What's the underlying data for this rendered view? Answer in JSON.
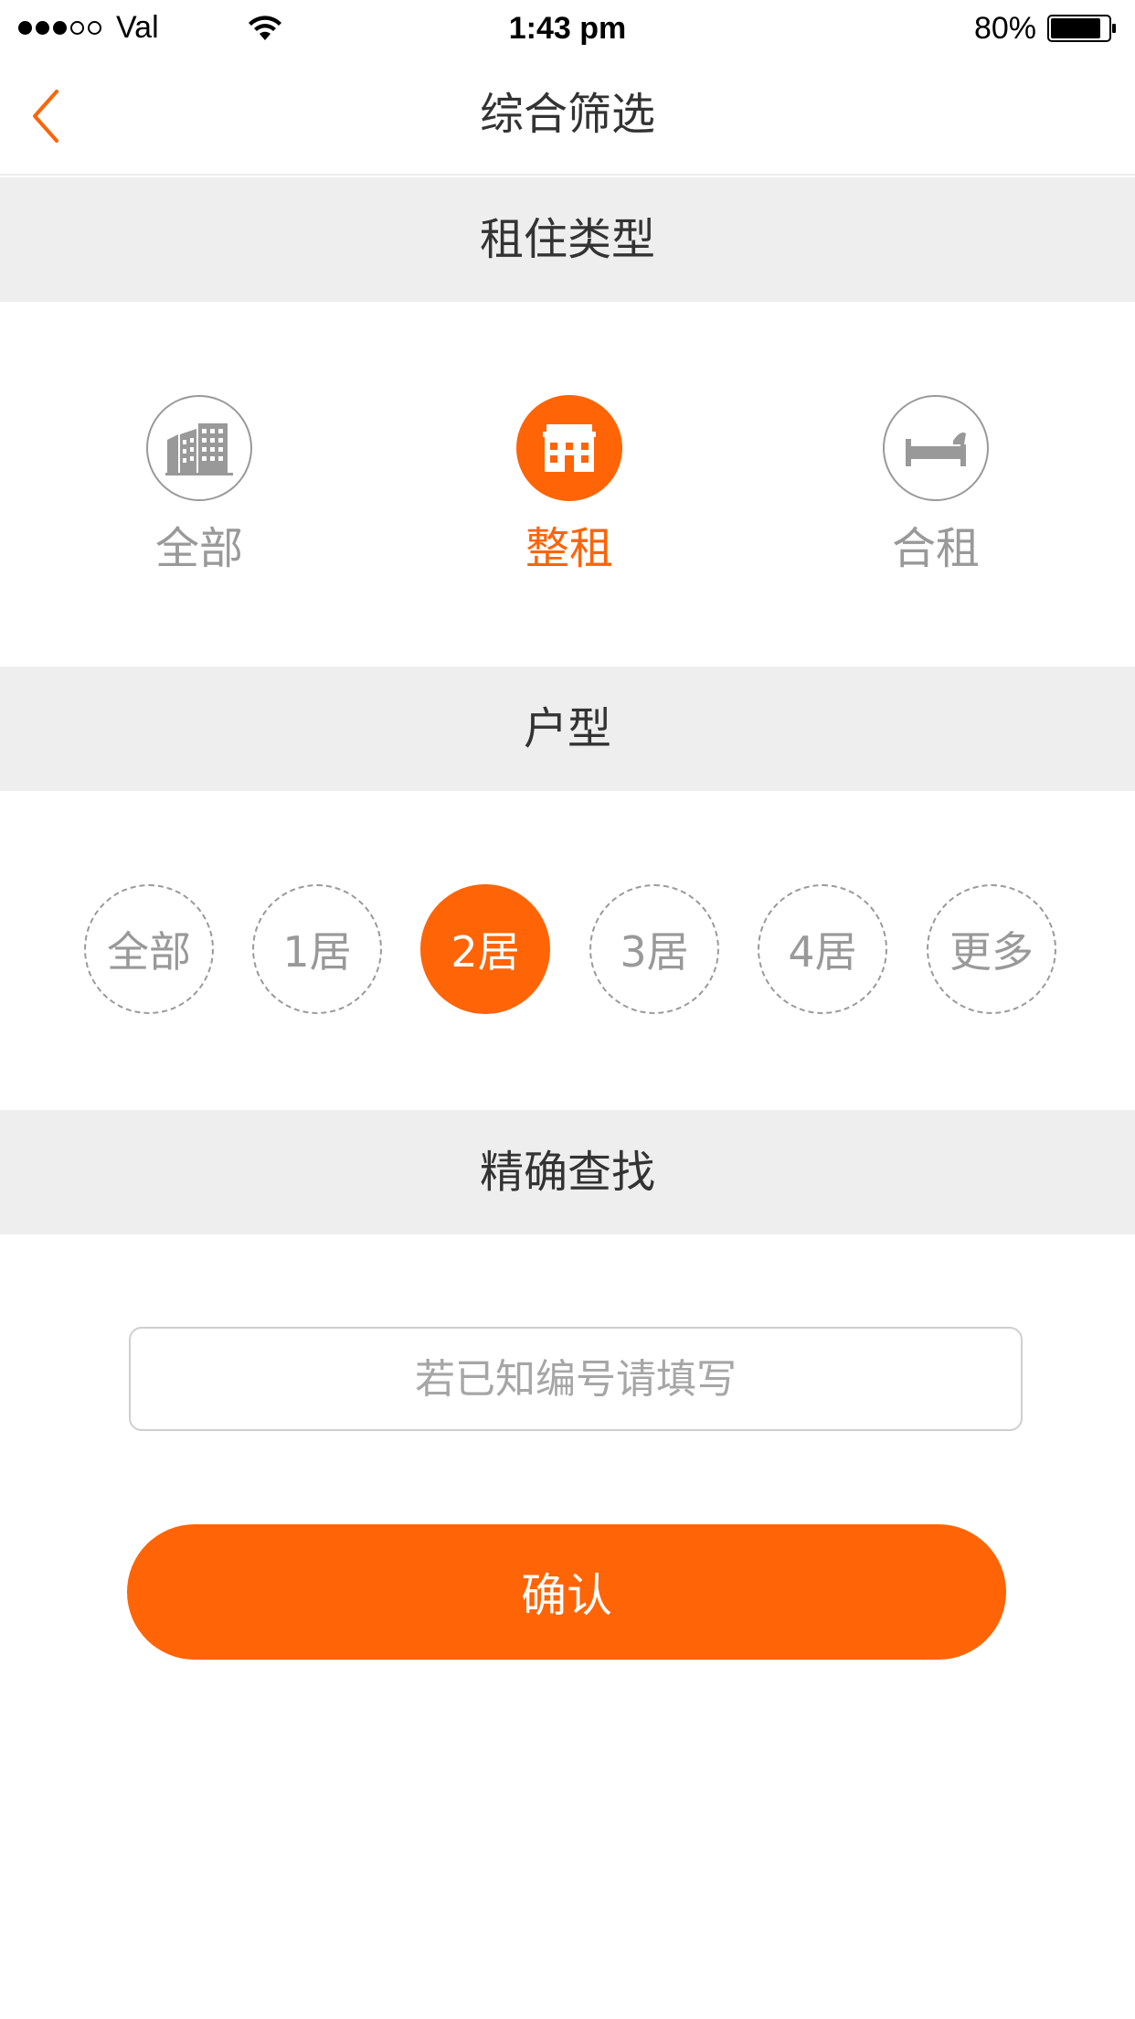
{
  "status_bar": {
    "carrier": "Val",
    "time": "1:43 pm",
    "battery": "80%"
  },
  "nav": {
    "title": "综合筛选"
  },
  "rental_type": {
    "header": "租住类型",
    "options": [
      {
        "label": "全部",
        "icon": "apartment-buildings-icon",
        "selected": false
      },
      {
        "label": "整租",
        "icon": "house-icon",
        "selected": true
      },
      {
        "label": "合租",
        "icon": "bed-icon",
        "selected": false
      }
    ]
  },
  "layout": {
    "header": "户型",
    "options": [
      {
        "label": "全部",
        "selected": false
      },
      {
        "label": "1居",
        "selected": false
      },
      {
        "label": "2居",
        "selected": true
      },
      {
        "label": "3居",
        "selected": false
      },
      {
        "label": "4居",
        "selected": false
      },
      {
        "label": "更多",
        "selected": false
      }
    ]
  },
  "exact_search": {
    "header": "精确查找",
    "placeholder": "若已知编号请填写",
    "value": ""
  },
  "confirm": {
    "label": "确认"
  },
  "colors": {
    "accent": "#ff6406",
    "section_bg": "#eeeeee",
    "muted_text": "#999999"
  }
}
